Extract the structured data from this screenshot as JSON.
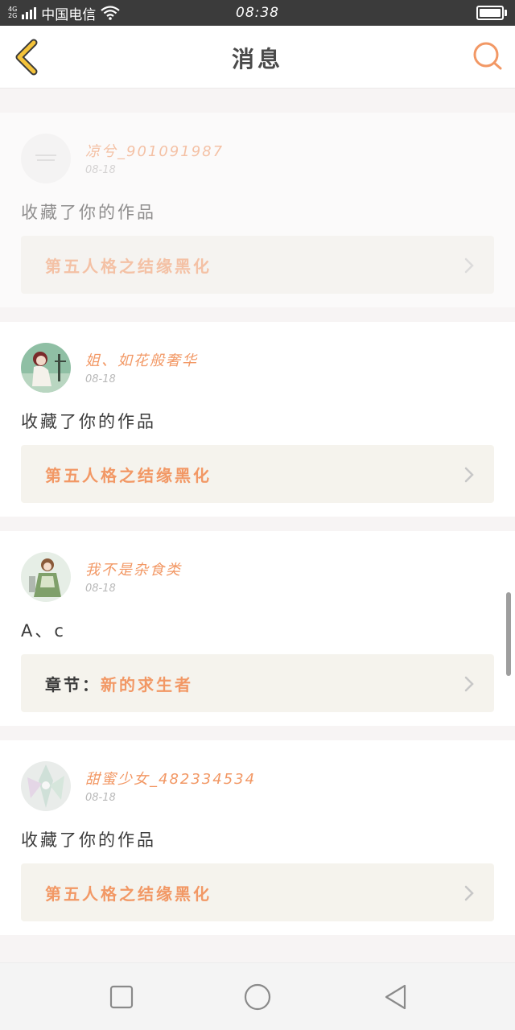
{
  "status_bar": {
    "network_top": "4G",
    "network_bottom": "2G",
    "carrier": "中国电信",
    "time": "08:38",
    "battery_level": 1.0
  },
  "header": {
    "title": "消息",
    "back_icon": "chevron-left-icon",
    "search_icon": "search-icon"
  },
  "colors": {
    "accent": "#f29865",
    "back_icon": "#f4c33a",
    "card_bg": "#ffffff",
    "link_bg": "#f5f3ed"
  },
  "messages": [
    {
      "username": "凉兮_901091987",
      "date": "08-18",
      "text": "收藏了你的作品",
      "link_prefix": "",
      "link_title": "第五人格之结缘黑化",
      "avatar_icon": "avatar-placeholder"
    },
    {
      "username": "姐、如花般奢华",
      "date": "08-18",
      "text": "收藏了你的作品",
      "link_prefix": "",
      "link_title": "第五人格之结缘黑化",
      "avatar_icon": "avatar-girl"
    },
    {
      "username": "我不是杂食类",
      "date": "08-18",
      "text": "A、c",
      "link_prefix": "章节：",
      "link_title": "新的求生者",
      "avatar_icon": "avatar-girl-green"
    },
    {
      "username": "甜蜜少女_482334534",
      "date": "08-18",
      "text": "收藏了你的作品",
      "link_prefix": "",
      "link_title": "第五人格之结缘黑化",
      "avatar_icon": "avatar-crystal"
    }
  ],
  "nav_bar": {
    "recent_icon": "square-icon",
    "home_icon": "circle-icon",
    "back_icon": "triangle-back-icon"
  }
}
